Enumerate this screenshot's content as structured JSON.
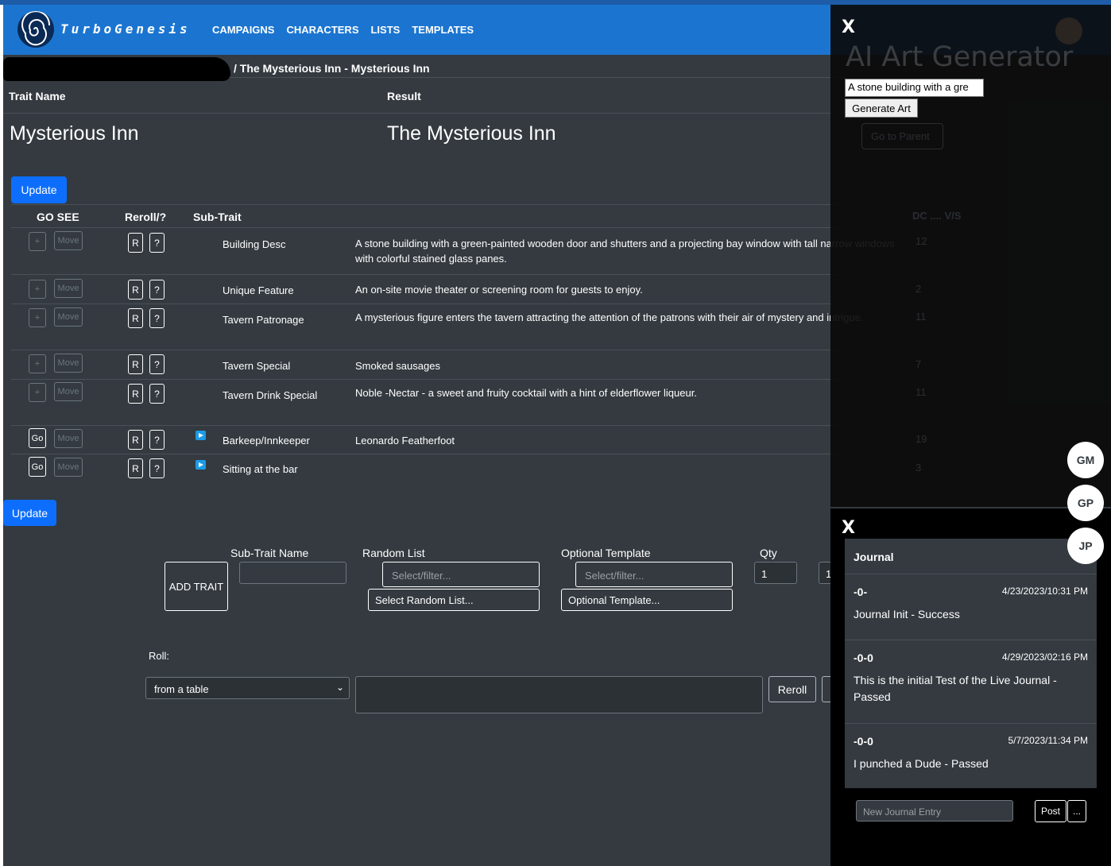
{
  "brand": {
    "name": "TurboGenesis"
  },
  "nav": [
    "CAMPAIGNS",
    "CHARACTERS",
    "LISTS",
    "TEMPLATES"
  ],
  "breadcrumb": {
    "current": "/  The Mysterious Inn - Mysterious Inn"
  },
  "headers": {
    "trait_name": "Trait Name",
    "result": "Result"
  },
  "trait": {
    "name": "Mysterious Inn",
    "result": "The Mysterious Inn"
  },
  "buttons": {
    "update": "Update",
    "update_bottom": "Update",
    "add_trait": "ADD TRAIT",
    "reroll": "Reroll",
    "go": "Go",
    "move": "Move",
    "plus": "+",
    "r": "R",
    "q": "?"
  },
  "table": {
    "headers": {
      "go_see": "GO SEE",
      "reroll": "Reroll/?",
      "sub_trait": "Sub-Trait",
      "dc": "DC .... V/S"
    },
    "rows": [
      {
        "name": "Building Desc",
        "result": "A stone building with a green-painted wooden door and shutters and a projecting bay window with tall narrow windows with colorful stained glass panes.",
        "dc": "12"
      },
      {
        "name": "Unique Feature",
        "result": "An on-site movie theater or screening room for guests to enjoy.",
        "dc": "2"
      },
      {
        "name": "Tavern Patronage",
        "result": "A mysterious figure enters the tavern attracting the attention of the patrons with their air of mystery and intrigue.",
        "dc": "11"
      },
      {
        "name": "Tavern Special",
        "result": "Smoked sausages",
        "dc": "7"
      },
      {
        "name": "Tavern Drink Special",
        "result": "Noble -Nectar - a sweet and fruity cocktail with a hint of elderflower liqueur.",
        "dc": "11"
      },
      {
        "name": "Barkeep/Innkeeper",
        "result": "Leonardo Featherfoot",
        "dc": "19"
      },
      {
        "name": "Sitting at the bar",
        "result": "",
        "dc": "3"
      }
    ]
  },
  "form": {
    "sub_trait_name": "Sub-Trait Name",
    "random_list": "Random List",
    "optional_template": "Optional Template",
    "qty": "Qty",
    "qty_value": "1",
    "qty2_value": "1",
    "filter_placeholder": "Select/filter...",
    "select_random_list": "Select Random List...",
    "select_optional_template": "Optional Template...",
    "roll_label": "Roll:",
    "roll_select": "from a table"
  },
  "ai_art": {
    "close": "X",
    "title": "AI Art Generator",
    "prompt_value": "A stone building with a gre",
    "generate": "Generate Art",
    "go_to_parent": "Go to Parent"
  },
  "journal": {
    "close": "X",
    "title": "Journal",
    "entries": [
      {
        "author": "-0-",
        "time": "4/23/2023/10:31 PM",
        "message": "Journal Init - Success"
      },
      {
        "author": "-0-0",
        "time": "4/29/2023/02:16 PM",
        "message": "This is the initial Test of the Live Journal - Passed"
      },
      {
        "author": "-0-0",
        "time": "5/7/2023/11:34 PM",
        "message": "I punched a Dude - Passed"
      }
    ],
    "new_entry_placeholder": "New Journal Entry",
    "post": "Post",
    "more": "..."
  },
  "avatars": [
    "GM",
    "GP",
    "JP"
  ],
  "colors": {
    "navbar": "#1b75d0",
    "background": "#343a40",
    "primary_button": "#0d6efd"
  }
}
